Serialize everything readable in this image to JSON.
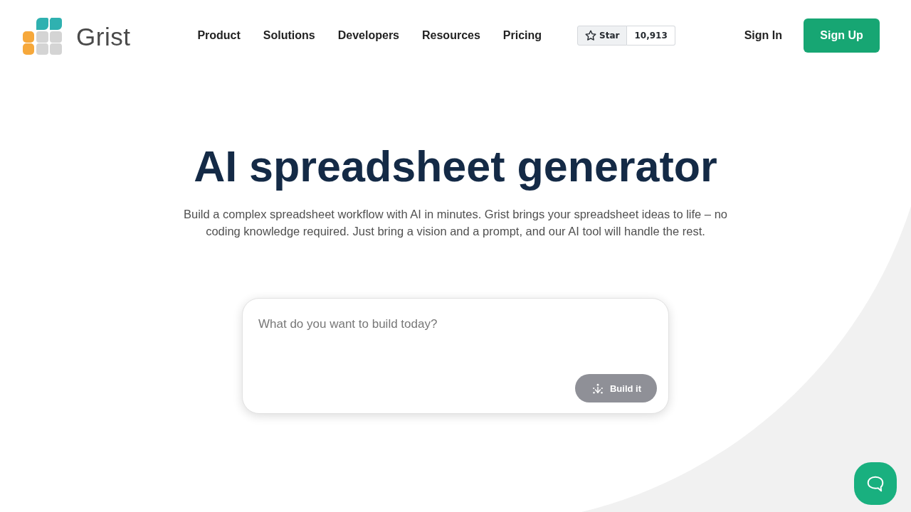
{
  "header": {
    "logo": {
      "text": "Grist"
    },
    "nav": [
      "Product",
      "Solutions",
      "Developers",
      "Resources",
      "Pricing"
    ],
    "github": {
      "star_label": "Star",
      "count": "10,913"
    },
    "sign_in": "Sign In",
    "sign_up": "Sign Up"
  },
  "hero": {
    "title": "AI spreadsheet generator",
    "description": "Build a complex spreadsheet workflow with AI in minutes. Grist brings your spreadsheet ideas to life – no coding knowledge required. Just bring a vision and a prompt, and our AI tool will handle the rest."
  },
  "prompt": {
    "placeholder": "What do you want to build today?",
    "button": {
      "label": "Build it",
      "disabled": true
    }
  }
}
